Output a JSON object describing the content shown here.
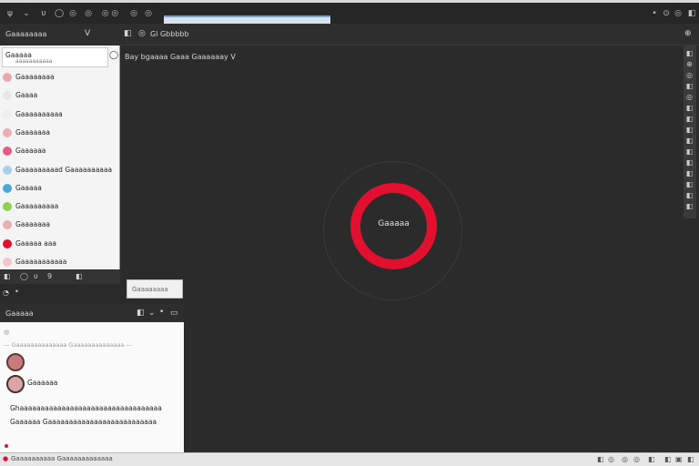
{
  "titlebar": {
    "left_icons": [
      "ψ",
      "⌄",
      "υ",
      "◯",
      "◎",
      "◎",
      "◎ ◎",
      "◎",
      "◎",
      "▭"
    ],
    "right_icons": [
      "•",
      "⊙",
      "◎",
      "◧"
    ]
  },
  "left_header": {
    "account_name": "Gaaaaaaaa",
    "chevron": "V"
  },
  "main_header": {
    "icon1": "◧",
    "icon2": "◎",
    "room_name": "Gl Gbbbbb",
    "topic": "Bay bgaaaa Gaaa Gaaaaaay V",
    "right_icon": "⊕"
  },
  "list": {
    "search_name": "Gaaaaa",
    "search_sub": "aaaaaaaaaaa",
    "search_icon": "◯",
    "rows": [
      {
        "label": "Gaaaaaaaa",
        "color": "#e8a8ad"
      },
      {
        "label": "Gaaaa",
        "color": "#e6e6e6"
      },
      {
        "label": "Gaaaaaaaaaa",
        "color": "#eeeeee"
      },
      {
        "label": "Gaaaaaaa",
        "color": "#e8b0b0"
      },
      {
        "label": "Gaaaaaa",
        "color": "#e65a84"
      },
      {
        "label": "Gaaaaaaaaad Gaaaaaaaaaa",
        "color": "#a8d0e6"
      },
      {
        "label": "Gaaaaa",
        "color": "#4aa9d6"
      },
      {
        "label": "Gaaaaaaaaa",
        "color": "#8cd24a"
      },
      {
        "label": "Gaaaaaaa",
        "color": "#e8b0b0"
      },
      {
        "label": "Gaaaaa aaa",
        "color": "#e2102f"
      },
      {
        "label": "Gaaaaaaaaaaa",
        "color": "#f0c8c8"
      }
    ]
  },
  "left_tools": [
    "◧",
    "◯",
    "υ",
    "9",
    "◧"
  ],
  "left_tools2": [
    "◔",
    "•"
  ],
  "float_button": "Gaaaaaaaa",
  "chat": {
    "header": "Gaaaaa",
    "header_icons": [
      "◧",
      "⌄",
      "•",
      "▭"
    ],
    "indicator": "◎",
    "line1": "— Gaaaaaaaaaaaaaa Gaaaaaaaaaaaaaa —",
    "user_name": "Gaaaaaa",
    "message1": "Ghaaaaaaaaaaaaaaaaaaaaaaaaaaaaaaaaaa",
    "message2": "Gaaaaaa Gaaaaaaaaaaaaaaaaaaaaaaaaaa"
  },
  "status": {
    "left_text": "Gaaaaaaaaaa Gaaaaaaaaaaaaa",
    "right_icons": [
      "◧",
      "◎",
      "◎",
      "◎",
      "◧",
      "◧",
      "▣",
      "◧"
    ]
  },
  "right_tools": [
    "◧",
    "⊕",
    "◎",
    "◧",
    "◎",
    "◧",
    "◧",
    "◧",
    "◧",
    "◧",
    "◧",
    "◧",
    "◧",
    "◧",
    "◧"
  ],
  "spinner": {
    "label": "Gaaaaa",
    "color": "#e2102f"
  }
}
